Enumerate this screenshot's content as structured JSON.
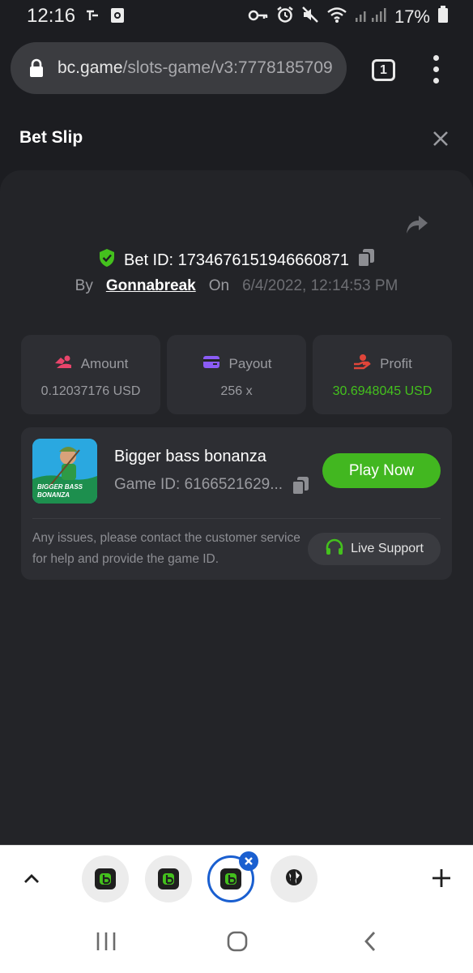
{
  "status_bar": {
    "time": "12:16",
    "battery": "17%",
    "icons": [
      "signal-t-icon",
      "photo-icon",
      "key-icon",
      "alarm-icon",
      "mute-icon",
      "wifi-icon",
      "signal-icon",
      "battery-icon"
    ]
  },
  "browser": {
    "url_domain": "bc.game",
    "url_path": "/slots-game/v3:7778185709",
    "tab_count": "1"
  },
  "header": {
    "title": "Bet Slip"
  },
  "bet": {
    "id_label": "Bet ID: 1734676151946660871",
    "by_label": "By",
    "user": "Gonnabreak",
    "on_label": "On",
    "date": "6/4/2022, 12:14:53 PM"
  },
  "stats": [
    {
      "label": "Amount",
      "value": "0.12037176 USD",
      "icon": "amount-icon",
      "color": "#e8456b"
    },
    {
      "label": "Payout",
      "value": "256 x",
      "icon": "payout-card-icon",
      "color": "#8b5cf6"
    },
    {
      "label": "Profit",
      "value": "30.6948045 USD",
      "icon": "profit-hand-icon",
      "color": "#e0453a"
    }
  ],
  "game": {
    "name": "Bigger bass bonanza",
    "id_label": "Game ID: 6166521629...",
    "thumb_text_1": "BIGGER BASS",
    "thumb_text_2": "BONANZA",
    "play_label": "Play Now",
    "support_text": "Any issues, please contact the customer service for help and provide the game ID.",
    "support_label": "Live Support"
  },
  "colors": {
    "accent_green": "#42b720",
    "profit_green": "#44c11d",
    "panel_bg": "#232428",
    "card_bg": "#2d2e33",
    "active_tab": "#1a5fd0"
  }
}
